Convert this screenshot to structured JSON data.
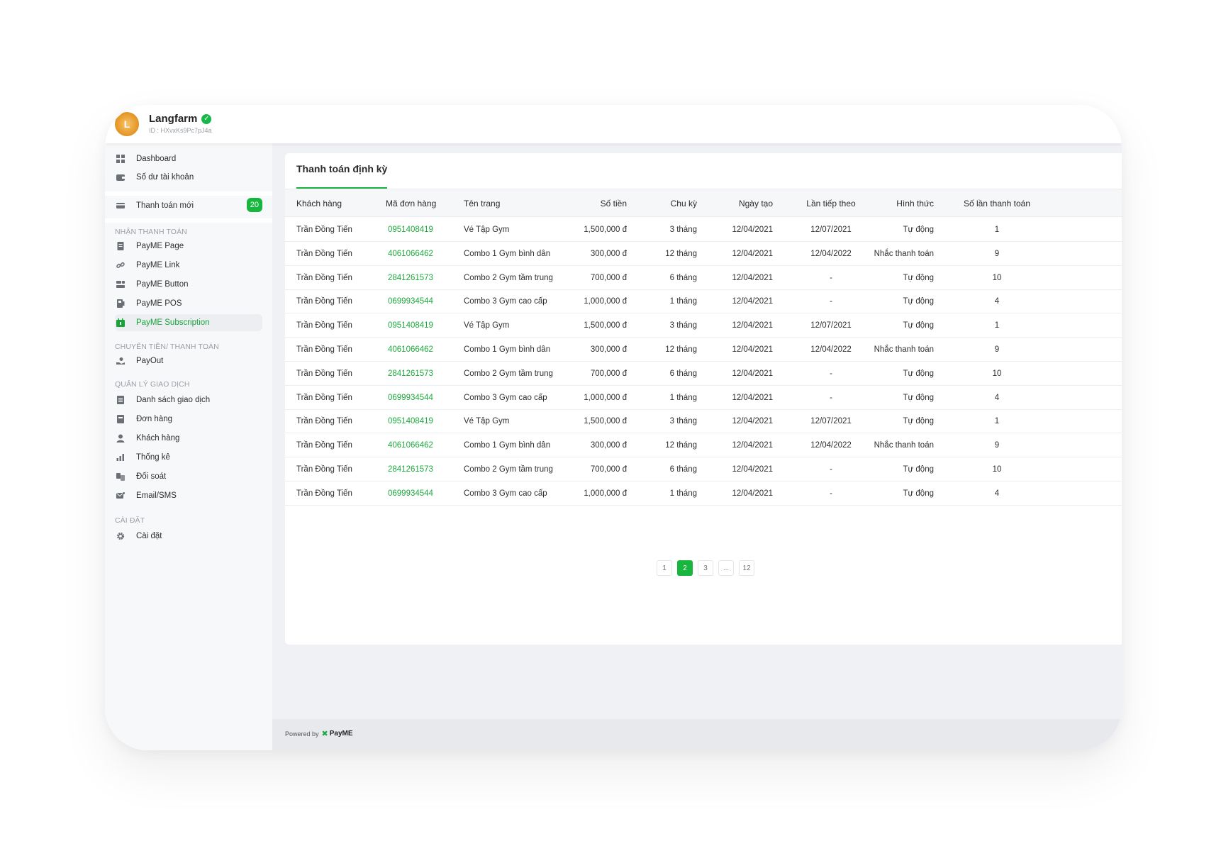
{
  "header": {
    "logo_text": "L",
    "brand": "Langfarm",
    "merchant_id": "ID : HXvxKs9Pc7pJ4a"
  },
  "sidebar": {
    "top_items": [
      {
        "label": "Dashboard",
        "icon": "grid-icon"
      },
      {
        "label": "Số dư tài khoản",
        "icon": "wallet-icon"
      }
    ],
    "new_payment": {
      "label": "Thanh toán mới",
      "badge": "20",
      "icon": "card-icon"
    },
    "sections": [
      {
        "title": "NHẬN THANH TOÁN",
        "items": [
          {
            "label": "PayME Page",
            "icon": "page-icon"
          },
          {
            "label": "PayME Link",
            "icon": "link-icon"
          },
          {
            "label": "PayME Button",
            "icon": "button-icon"
          },
          {
            "label": "PayME POS",
            "icon": "pos-icon"
          },
          {
            "label": "PayME Subscription",
            "icon": "subscription-icon",
            "active": true
          }
        ]
      },
      {
        "title": "CHUYỂN TIỀN/ THANH TOÁN",
        "items": [
          {
            "label": "PayOut",
            "icon": "payout-icon"
          }
        ]
      },
      {
        "title": "QUẢN LÝ GIAO DỊCH",
        "items": [
          {
            "label": "Danh sách giao dịch",
            "icon": "list-icon"
          },
          {
            "label": "Đơn hàng",
            "icon": "order-icon"
          },
          {
            "label": "Khách hàng",
            "icon": "user-icon"
          },
          {
            "label": "Thống kê",
            "icon": "stats-icon"
          },
          {
            "label": "Đối soát",
            "icon": "reconcile-icon"
          },
          {
            "label": "Email/SMS",
            "icon": "email-icon"
          }
        ]
      },
      {
        "title": "CÀI ĐẶT",
        "items": [
          {
            "label": "Cài đặt",
            "icon": "gear-icon"
          }
        ]
      }
    ]
  },
  "main": {
    "tab": "Thanh toán định kỳ",
    "columns": [
      "Khách hàng",
      "Mã đơn hàng",
      "Tên trang",
      "Số tiền",
      "Chu kỳ",
      "Ngày tạo",
      "Lần tiếp theo",
      "Hình thức",
      "Số lần thanh toán"
    ],
    "rows": [
      [
        "Trần Đồng Tiến",
        "0951408419",
        "Vé Tập Gym",
        "1,500,000 đ",
        "3 tháng",
        "12/04/2021",
        "12/07/2021",
        "Tự động",
        "1"
      ],
      [
        "Trần Đồng Tiến",
        "4061066462",
        "Combo 1 Gym bình dân",
        "300,000 đ",
        "12 tháng",
        "12/04/2021",
        "12/04/2022",
        "Nhắc thanh toán",
        "9"
      ],
      [
        "Trần Đồng Tiến",
        "2841261573",
        "Combo 2 Gym tầm trung",
        "700,000 đ",
        "6 tháng",
        "12/04/2021",
        "-",
        "Tự động",
        "10"
      ],
      [
        "Trần Đồng Tiến",
        "0699934544",
        "Combo 3 Gym cao cấp",
        "1,000,000 đ",
        "1 tháng",
        "12/04/2021",
        "-",
        "Tự động",
        "4"
      ],
      [
        "Trần Đồng Tiến",
        "0951408419",
        "Vé Tập Gym",
        "1,500,000 đ",
        "3 tháng",
        "12/04/2021",
        "12/07/2021",
        "Tự động",
        "1"
      ],
      [
        "Trần Đồng Tiến",
        "4061066462",
        "Combo 1 Gym bình dân",
        "300,000 đ",
        "12 tháng",
        "12/04/2021",
        "12/04/2022",
        "Nhắc thanh toán",
        "9"
      ],
      [
        "Trần Đồng Tiến",
        "2841261573",
        "Combo 2 Gym tầm trung",
        "700,000 đ",
        "6 tháng",
        "12/04/2021",
        "-",
        "Tự động",
        "10"
      ],
      [
        "Trần Đồng Tiến",
        "0699934544",
        "Combo 3 Gym cao cấp",
        "1,000,000 đ",
        "1 tháng",
        "12/04/2021",
        "-",
        "Tự động",
        "4"
      ],
      [
        "Trần Đồng Tiến",
        "0951408419",
        "Vé Tập Gym",
        "1,500,000 đ",
        "3 tháng",
        "12/04/2021",
        "12/07/2021",
        "Tự động",
        "1"
      ],
      [
        "Trần Đồng Tiến",
        "4061066462",
        "Combo 1 Gym bình dân",
        "300,000 đ",
        "12 tháng",
        "12/04/2021",
        "12/04/2022",
        "Nhắc thanh toán",
        "9"
      ],
      [
        "Trần Đồng Tiến",
        "2841261573",
        "Combo 2 Gym tầm trung",
        "700,000 đ",
        "6 tháng",
        "12/04/2021",
        "-",
        "Tự động",
        "10"
      ],
      [
        "Trần Đồng Tiến",
        "0699934544",
        "Combo 3 Gym cao cấp",
        "1,000,000 đ",
        "1 tháng",
        "12/04/2021",
        "-",
        "Tự động",
        "4"
      ]
    ],
    "pagination": {
      "pages": [
        "1",
        "2",
        "3",
        "...",
        "12"
      ],
      "current": "2"
    }
  },
  "footer": {
    "powered_by": "Powered by",
    "brand": "PayME"
  },
  "colors": {
    "accent": "#18b53f",
    "code_text": "#1caa3d"
  }
}
